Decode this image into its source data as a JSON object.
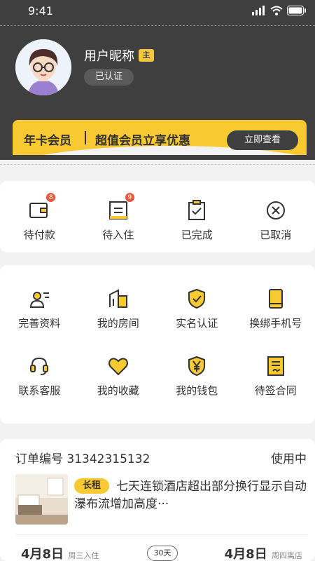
{
  "status_bar": {
    "time": "9:41"
  },
  "profile": {
    "nickname": "用户昵称",
    "crown_label": "主",
    "verified": "已认证"
  },
  "vip": {
    "title": "年卡会员",
    "subtitle": "超值会员立享优惠",
    "button": "立即查看"
  },
  "orders": [
    {
      "label": "待付款",
      "badge": "8",
      "icon": "wallet-icon"
    },
    {
      "label": "待入住",
      "badge": "9",
      "icon": "checkin-list-icon"
    },
    {
      "label": "已完成",
      "badge": "",
      "icon": "clipboard-check-icon"
    },
    {
      "label": "已取消",
      "badge": "",
      "icon": "cancel-circle-icon"
    }
  ],
  "services": [
    {
      "label": "完善资料",
      "icon": "profile-card-icon"
    },
    {
      "label": "我的房间",
      "icon": "building-icon"
    },
    {
      "label": "实名认证",
      "icon": "shield-check-icon"
    },
    {
      "label": "换绑手机号",
      "icon": "phone-icon"
    },
    {
      "label": "联系客服",
      "icon": "headset-icon"
    },
    {
      "label": "我的收藏",
      "icon": "heart-icon"
    },
    {
      "label": "我的钱包",
      "icon": "yen-shield-icon"
    },
    {
      "label": "待签合同",
      "icon": "contract-icon"
    }
  ],
  "order": {
    "number_label": "订单编号 31342315132",
    "status": "使用中",
    "tag": "长租",
    "title": "七天连锁酒店超出部分换行显示自动瀑布流增加高度···",
    "checkin_date": "4月8日",
    "checkin_note": "周三入住",
    "nights": "30天",
    "checkout_date": "4月8日",
    "checkout_note": "周四离店"
  },
  "colors": {
    "accent": "#f9c931",
    "dark": "#3f3f3f",
    "badge": "#e85a3c"
  }
}
